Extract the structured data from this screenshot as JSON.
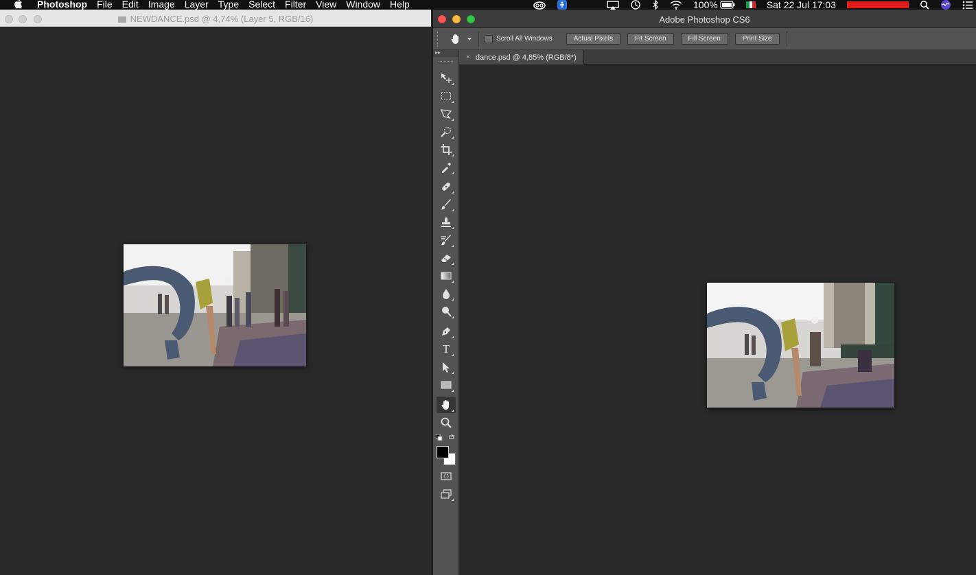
{
  "menubar": {
    "app_name": "Photoshop",
    "items": [
      "File",
      "Edit",
      "Image",
      "Layer",
      "Type",
      "Select",
      "Filter",
      "View",
      "Window",
      "Help"
    ],
    "battery": "100%",
    "datetime": "Sat 22 Jul  17:03"
  },
  "left_window": {
    "title": "NEWDANCE.psd @ 4,74% (Layer 5, RGB/16)"
  },
  "right_window": {
    "title": "Adobe Photoshop CS6",
    "options": {
      "scroll_all_label": "Scroll All Windows",
      "scroll_all_checked": false,
      "buttons": [
        "Actual Pixels",
        "Fit Screen",
        "Fill Screen",
        "Print Size"
      ]
    },
    "tab": {
      "close": "×",
      "label": "dance.psd @ 4,85% (RGB/8*)"
    }
  },
  "toolbox": {
    "tools": [
      "move-tool",
      "marquee-tool",
      "lasso-tool",
      "quick-selection-tool",
      "crop-tool",
      "eyedropper-tool",
      "healing-brush-tool",
      "brush-tool",
      "clone-stamp-tool",
      "history-brush-tool",
      "eraser-tool",
      "gradient-tool",
      "blur-tool",
      "dodge-tool",
      "pen-tool",
      "type-tool",
      "path-selection-tool",
      "rectangle-tool",
      "hand-tool",
      "zoom-tool"
    ],
    "active_tool": "hand-tool",
    "type_tool_glyph": "T",
    "foreground_color": "#000000",
    "background_color": "#ffffff"
  },
  "colors": {
    "canvas": "#282828",
    "panel": "#535353",
    "menubar": "#101010",
    "traffic_red": "#fc5753",
    "traffic_yellow": "#fdbc40",
    "traffic_green": "#33c748",
    "notification_red": "#e01c1c"
  }
}
